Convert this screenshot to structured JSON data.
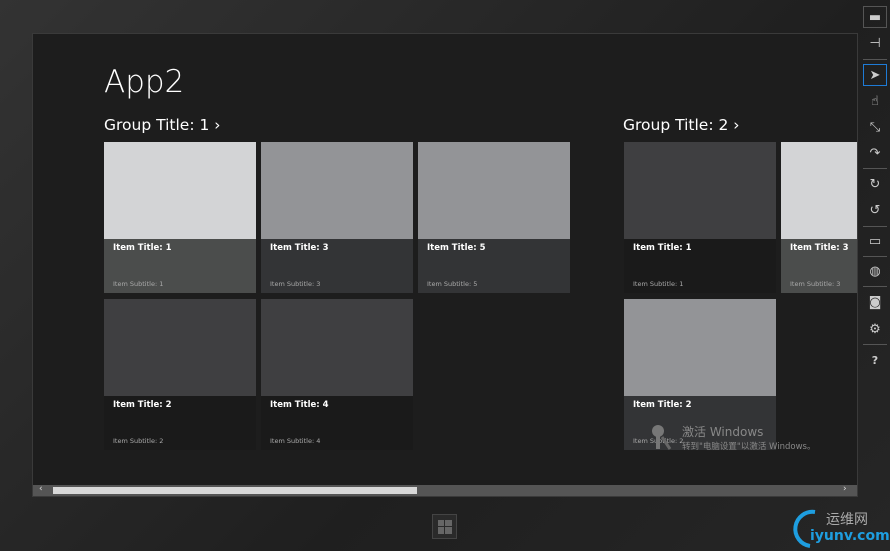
{
  "app": {
    "title": "App2"
  },
  "groups": [
    {
      "title": "Group Title: 1 ›",
      "items": [
        {
          "title": "Item Title: 1",
          "subtitle": "Item Subtitle: 1"
        },
        {
          "title": "Item Title: 2",
          "subtitle": "Item Subtitle: 2"
        },
        {
          "title": "Item Title: 3",
          "subtitle": "Item Subtitle: 3"
        },
        {
          "title": "Item Title: 4",
          "subtitle": "Item Subtitle: 4"
        },
        {
          "title": "Item Title: 5",
          "subtitle": "Item Subtitle: 5"
        }
      ]
    },
    {
      "title": "Group Title: 2 ›",
      "items": [
        {
          "title": "Item Title: 1",
          "subtitle": "Item Subtitle: 1"
        },
        {
          "title": "Item Title: 2",
          "subtitle": "Item Subtitle: 2"
        },
        {
          "title": "Item Title: 3",
          "subtitle": "Item Subtitle: 3"
        }
      ]
    }
  ],
  "scrollbar": {
    "left": "‹",
    "right": "›"
  },
  "watermark": {
    "line1": "激活 Windows",
    "line2": "转到\"电脑设置\"以激活 Windows。"
  },
  "site": {
    "cn": "运维网",
    "en": "iyunv.com"
  },
  "toolbar": {
    "help": "?"
  }
}
